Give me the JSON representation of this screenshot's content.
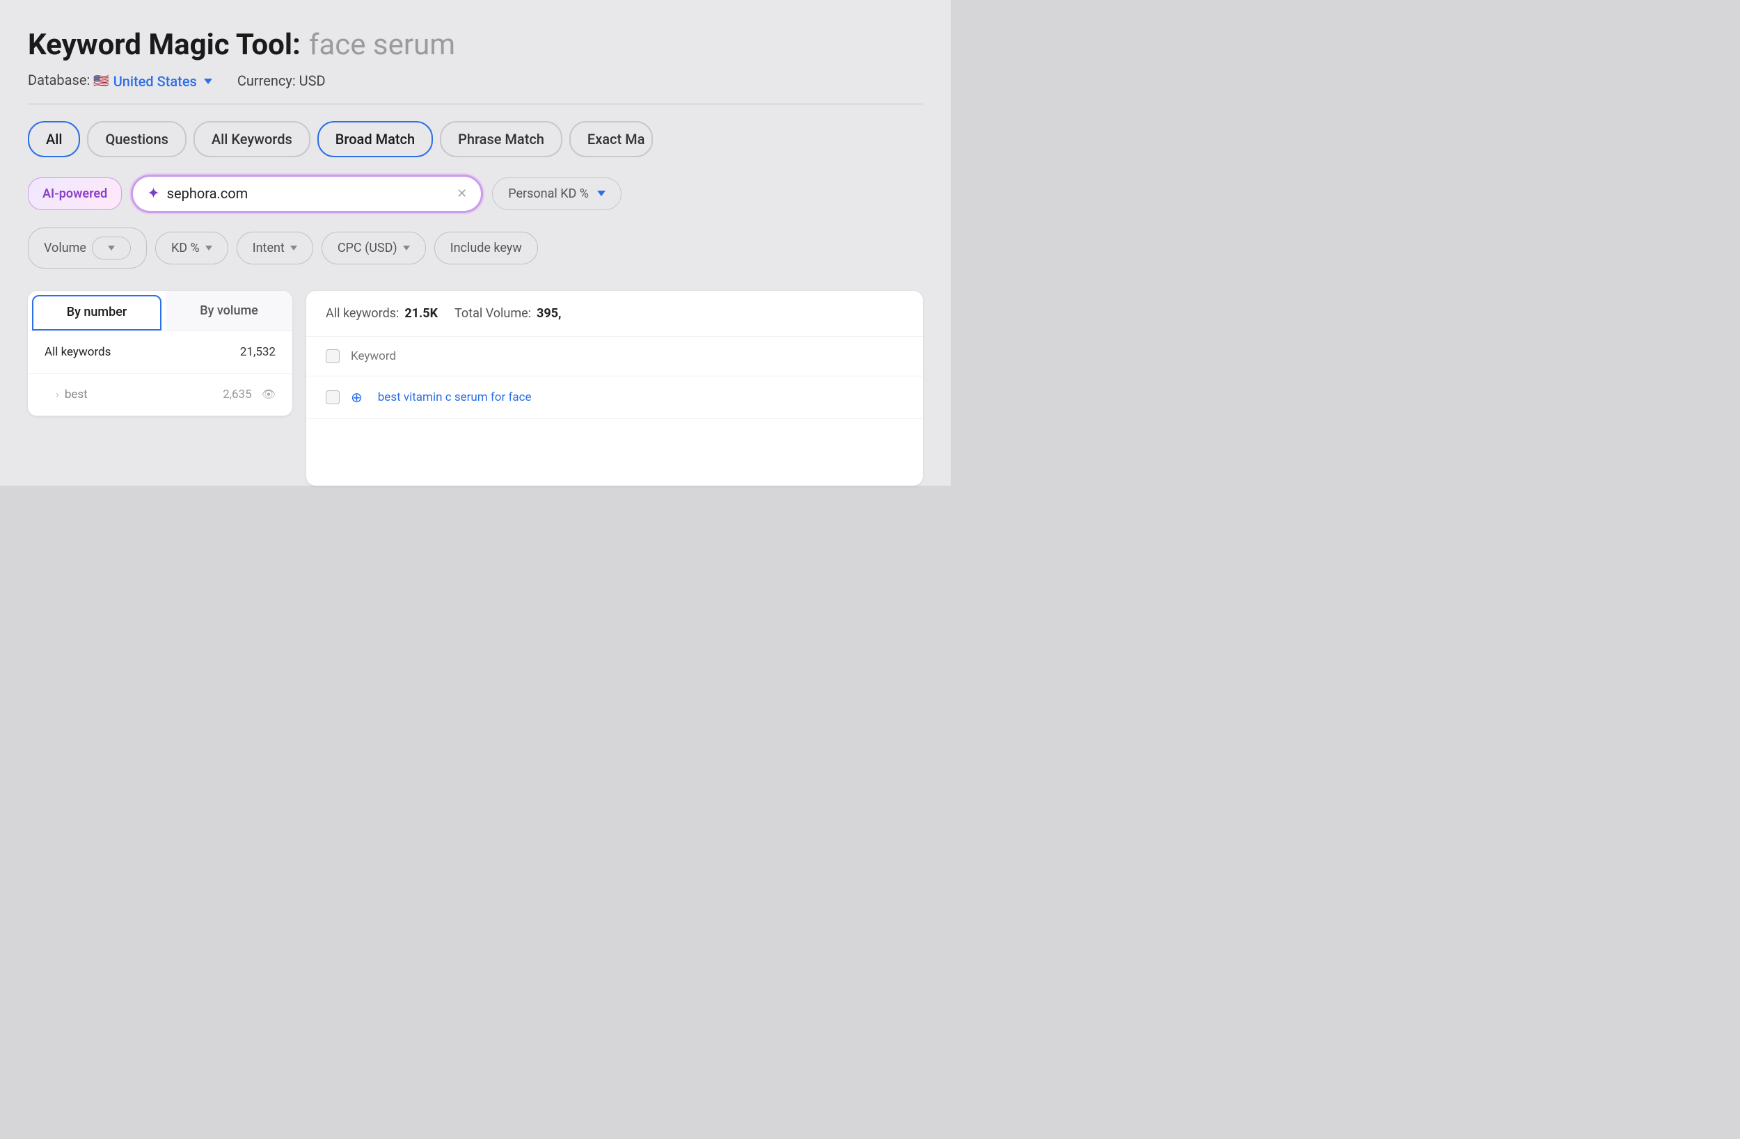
{
  "page": {
    "title": "Keyword Magic Tool:",
    "query": "face serum"
  },
  "meta": {
    "database_label": "Database:",
    "database_value": "United States",
    "database_flag": "🇺🇸",
    "currency_label": "Currency: USD"
  },
  "tabs": [
    {
      "id": "all",
      "label": "All",
      "active": true,
      "selected": false
    },
    {
      "id": "questions",
      "label": "Questions",
      "active": false
    },
    {
      "id": "all-keywords",
      "label": "All Keywords",
      "active": false
    },
    {
      "id": "broad-match",
      "label": "Broad Match",
      "active": false,
      "highlighted": true
    },
    {
      "id": "phrase-match",
      "label": "Phrase Match",
      "active": false
    },
    {
      "id": "exact-match",
      "label": "Exact Ma",
      "active": false,
      "truncated": true
    }
  ],
  "filter": {
    "ai_label": "AI-powered",
    "search_value": "sephora.com",
    "personal_kd_label": "Personal KD %"
  },
  "filter_buttons": [
    {
      "id": "volume",
      "label": "Volume"
    },
    {
      "id": "kd",
      "label": "KD %"
    },
    {
      "id": "intent",
      "label": "Intent"
    },
    {
      "id": "cpc",
      "label": "CPC (USD)"
    },
    {
      "id": "include",
      "label": "Include keyw"
    }
  ],
  "left_panel": {
    "by_tabs": [
      {
        "id": "by-number",
        "label": "By number",
        "active": true
      },
      {
        "id": "by-volume",
        "label": "By volume",
        "active": false
      }
    ],
    "items": [
      {
        "id": "all-keywords",
        "label": "All keywords",
        "count": "21,532",
        "indent": false
      },
      {
        "id": "best",
        "label": "best",
        "count": "2,635",
        "indent": true,
        "has_eye": true
      }
    ]
  },
  "right_panel": {
    "summary": "All keywords:",
    "total_count": "21.5K",
    "total_volume_label": "Total Volume:",
    "total_volume": "395,",
    "table_header": "Keyword",
    "rows": [
      {
        "id": "row-1",
        "keyword": "best vitamin c serum for face",
        "has_add": true
      }
    ]
  },
  "icons": {
    "sparkle": "✦",
    "clear": "✕",
    "chevron_down": "▾",
    "eye": "👁",
    "chevron_right": "›",
    "add_circle": "⊕"
  }
}
